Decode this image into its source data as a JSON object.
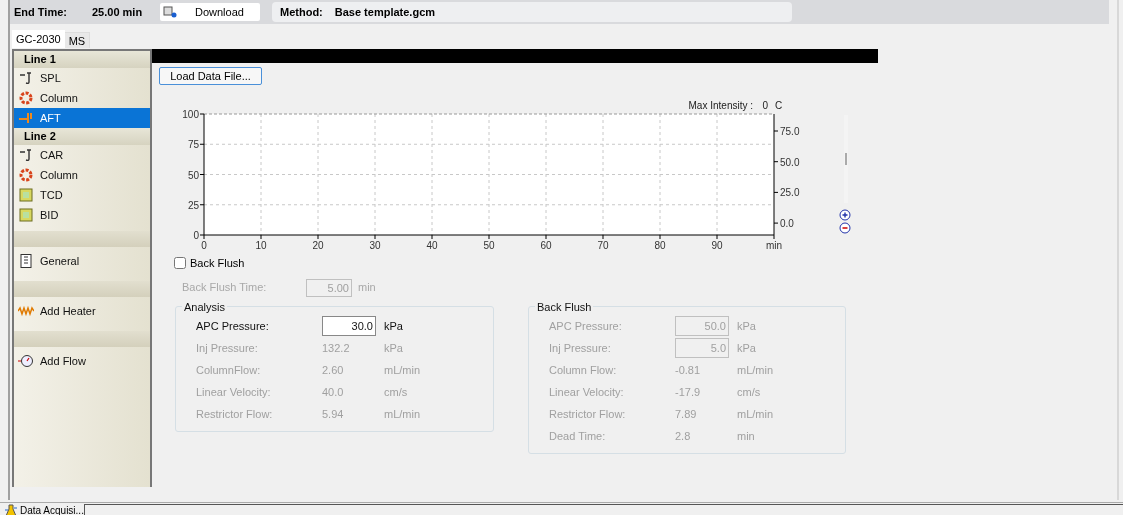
{
  "header": {
    "end_time_label": "End Time:",
    "end_time_value": "25.00 min",
    "download_button": "Download",
    "method_label": "Method:",
    "method_value": "Base template.gcm"
  },
  "device_tabs": [
    {
      "label": "GC-2030",
      "selected": true
    },
    {
      "label": "MS",
      "selected": false
    }
  ],
  "sidebar": {
    "groups": [
      {
        "title": "Line 1",
        "items": [
          {
            "label": "SPL",
            "kind": "injector",
            "selected": false
          },
          {
            "label": "Column",
            "kind": "column",
            "selected": false
          },
          {
            "label": "AFT",
            "kind": "aft",
            "selected": true
          }
        ]
      },
      {
        "title": "Line 2",
        "items": [
          {
            "label": "CAR",
            "kind": "injector",
            "selected": false
          },
          {
            "label": "Column",
            "kind": "column",
            "selected": false
          },
          {
            "label": "TCD",
            "kind": "detector",
            "selected": false
          },
          {
            "label": "BID",
            "kind": "detector",
            "selected": false
          }
        ]
      },
      {
        "items": [
          {
            "label": "General",
            "kind": "general",
            "selected": false
          }
        ]
      },
      {
        "items": [
          {
            "label": "Add Heater",
            "kind": "heater",
            "selected": false
          }
        ]
      },
      {
        "items": [
          {
            "label": "Add Flow",
            "kind": "flow",
            "selected": false
          }
        ]
      }
    ]
  },
  "load_button": "Load Data File...",
  "chart": {
    "max_intensity_label": "Max Intensity :",
    "max_intensity_value": "0",
    "max_intensity_unit": "C",
    "right_axis_labels": [
      "75.0",
      "50.0",
      "25.0",
      "0.0"
    ],
    "chart_data": {
      "type": "line",
      "grid": true,
      "xlabel": "min",
      "xlim": [
        0,
        100
      ],
      "ylim": [
        0,
        100
      ],
      "xticks": [
        0,
        10,
        20,
        30,
        40,
        50,
        60,
        70,
        80,
        90
      ],
      "yticks": [
        0,
        25,
        50,
        75,
        100
      ]
    }
  },
  "back_flush": {
    "label": "Back Flush",
    "checked": false,
    "time_label": "Back Flush Time:",
    "time_value": "5.00",
    "time_unit": "min"
  },
  "analysis": {
    "title": "Analysis",
    "rows": [
      {
        "label": "APC Pressure:",
        "value": "30.0",
        "unit": "kPa",
        "kind": "field",
        "disabled": false
      },
      {
        "label": "Inj Pressure:",
        "value": "132.2",
        "unit": "kPa",
        "kind": "readout",
        "disabled": true
      },
      {
        "label": "ColumnFlow:",
        "value": "2.60",
        "unit": "mL/min",
        "kind": "readout",
        "disabled": true
      },
      {
        "label": "Linear Velocity:",
        "value": "40.0",
        "unit": "cm/s",
        "kind": "readout",
        "disabled": true
      },
      {
        "label": "Restrictor Flow:",
        "value": "5.94",
        "unit": "mL/min",
        "kind": "readout",
        "disabled": true
      }
    ]
  },
  "back_flush_group": {
    "title": "Back Flush",
    "rows": [
      {
        "label": "APC Pressure:",
        "value": "50.0",
        "unit": "kPa",
        "kind": "field",
        "disabled": true
      },
      {
        "label": "Inj Pressure:",
        "value": "5.0",
        "unit": "kPa",
        "kind": "field",
        "disabled": true
      },
      {
        "label": "Column Flow:",
        "value": "-0.81",
        "unit": "mL/min",
        "kind": "readout",
        "disabled": true
      },
      {
        "label": "Linear Velocity:",
        "value": "-17.9",
        "unit": "cm/s",
        "kind": "readout",
        "disabled": true
      },
      {
        "label": "Restrictor Flow:",
        "value": "7.89",
        "unit": "mL/min",
        "kind": "readout",
        "disabled": true
      },
      {
        "label": "Dead Time:",
        "value": "2.8",
        "unit": "min",
        "kind": "readout",
        "disabled": true
      }
    ]
  },
  "status_tab": {
    "label": "Data Acquisi..."
  }
}
